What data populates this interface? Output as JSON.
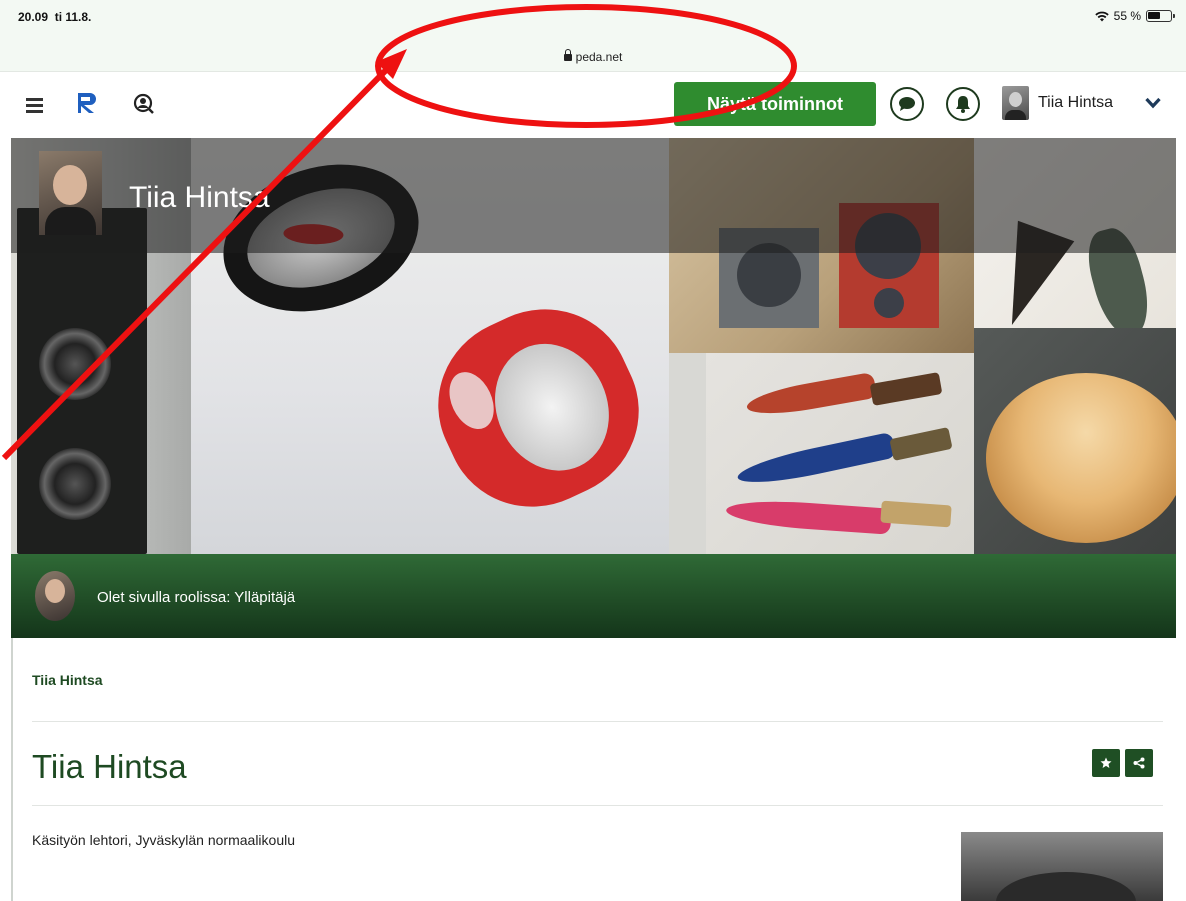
{
  "status_bar": {
    "time": "20.09",
    "date": "ti 11.8.",
    "url": "peda.net",
    "battery": "55 %",
    "battery_level": 0.55
  },
  "navbar": {
    "menu_icon": "hamburger-menu-icon",
    "logo_icon": "peda-logo-icon",
    "search_icon": "user-search-icon",
    "actions_button": "Näytä toiminnot",
    "chat_icon": "chat-bubble-icon",
    "bell_icon": "bell-icon",
    "user_name": "Tiia Hintsa",
    "dropdown_icon": "chevron-down-icon"
  },
  "banner": {
    "title": "Tiia Hintsa"
  },
  "role_bar": {
    "text": "Olet sivulla roolissa: Ylläpitäjä"
  },
  "breadcrumb": "Tiia Hintsa",
  "page": {
    "title": "Tiia Hintsa",
    "favorite_icon": "star-icon",
    "share_icon": "share-icon",
    "description": "Käsityön lehtori, Jyväskylän normaalikoulu"
  },
  "colors": {
    "primary_green": "#2f8c2f",
    "dark_green": "#1e4a22",
    "annotation_red": "#ee1111"
  }
}
